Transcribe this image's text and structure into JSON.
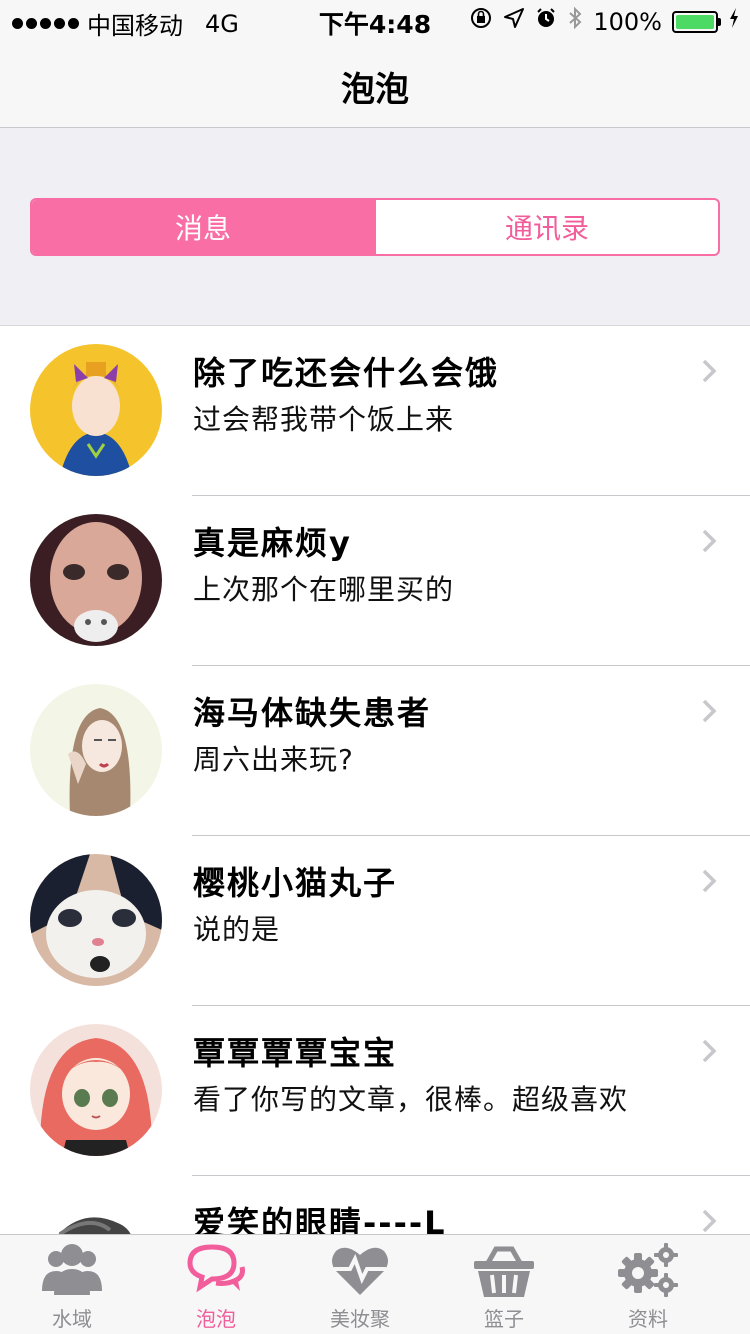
{
  "status_bar": {
    "carrier": "中国移动",
    "network": "4G",
    "time": "下午4:48",
    "battery": "100%",
    "battery_level": 1.0
  },
  "nav": {
    "title": "泡泡"
  },
  "segment": {
    "items": [
      {
        "label": "消息",
        "active": true
      },
      {
        "label": "通讯录",
        "active": false
      }
    ]
  },
  "conversations": [
    {
      "name": "除了吃还会什么会饿",
      "message": "过会帮我带个饭上来",
      "avatar": "avatar-girl-yellow"
    },
    {
      "name": "真是麻烦y",
      "message": "上次那个在哪里买的",
      "avatar": "avatar-child"
    },
    {
      "name": "海马体缺失患者",
      "message": "周六出来玩?",
      "avatar": "avatar-girl-sketch"
    },
    {
      "name": "樱桃小猫丸子",
      "message": "说的是",
      "avatar": "avatar-cat"
    },
    {
      "name": "覃覃覃覃宝宝",
      "message": "看了你写的文章，很棒。超级喜欢",
      "avatar": "avatar-anime-girl"
    },
    {
      "name": "爱笑的眼睛----L",
      "message": "",
      "avatar": "avatar-sketch"
    }
  ],
  "tabs": [
    {
      "label": "水域",
      "icon": "group-icon",
      "active": false
    },
    {
      "label": "泡泡",
      "icon": "chat-bubbles-icon",
      "active": true
    },
    {
      "label": "美妆聚",
      "icon": "heart-pulse-icon",
      "active": false
    },
    {
      "label": "篮子",
      "icon": "basket-icon",
      "active": false
    },
    {
      "label": "资料",
      "icon": "gears-icon",
      "active": false
    }
  ],
  "colors": {
    "accent": "#f96fa5",
    "accent_text": "#f25e9b",
    "tab_inactive": "#8e8e93"
  }
}
